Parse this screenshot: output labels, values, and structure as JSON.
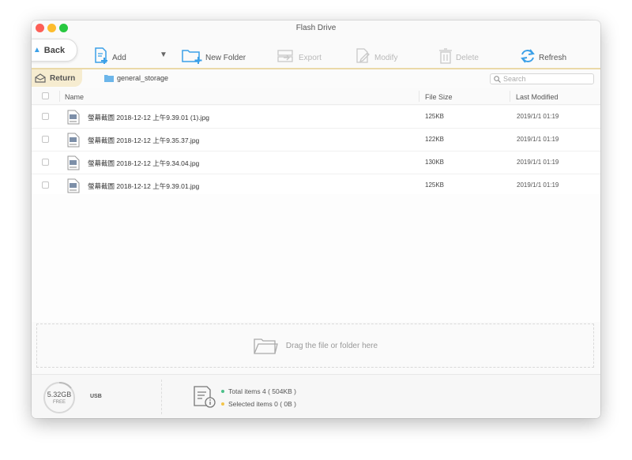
{
  "window": {
    "title": "Flash Drive"
  },
  "toolbar": {
    "back_label": "Back",
    "add_label": "Add",
    "new_folder_label": "New Folder",
    "export_label": "Export",
    "modify_label": "Modify",
    "delete_label": "Delete",
    "refresh_label": "Refresh"
  },
  "pathbar": {
    "return_label": "Return",
    "folder_name": "general_storage",
    "search_placeholder": "Search"
  },
  "table": {
    "columns": [
      "Name",
      "File Size",
      "Last Modified"
    ],
    "rows": [
      {
        "name": "螢幕截圖 2018-12-12 上午9.39.01 (1).jpg",
        "size": "125KB",
        "modified": "2019/1/1  01:19"
      },
      {
        "name": "螢幕截圖 2018-12-12 上午9.35.37.jpg",
        "size": "122KB",
        "modified": "2019/1/1  01:19"
      },
      {
        "name": "螢幕截圖 2018-12-12 上午9.34.04.jpg",
        "size": "130KB",
        "modified": "2019/1/1  01:19"
      },
      {
        "name": "螢幕截圖 2018-12-12 上午9.39.01.jpg",
        "size": "125KB",
        "modified": "2019/1/1  01:19"
      }
    ]
  },
  "dropzone": {
    "text": "Drag the file or folder here"
  },
  "status": {
    "free_space": "5.32GB",
    "free_label": "FREE",
    "device": "USB",
    "total_items": "Total items 4 ( 504KB )",
    "selected_items": "Selected items 0 ( 0B )"
  },
  "colors": {
    "accent_blue": "#3ba0e8",
    "return_tab": "#f6ecd0",
    "total_dot": "#4cc08a",
    "selected_dot": "#f3c54a"
  },
  "icons": [
    "back-arrow-icon",
    "add-file-icon",
    "new-folder-icon",
    "export-icon",
    "modify-icon",
    "delete-icon",
    "refresh-icon",
    "return-icon",
    "folder-icon",
    "search-icon",
    "file-icon",
    "drop-folder-icon",
    "info-icon"
  ]
}
